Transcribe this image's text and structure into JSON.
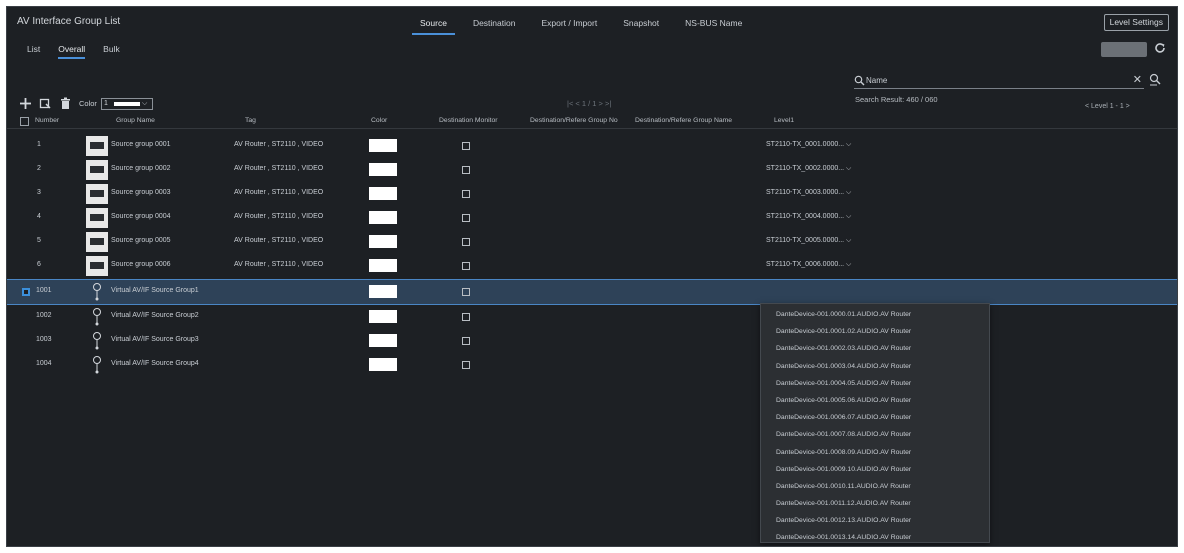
{
  "window": {
    "title": "AV Interface Group List",
    "level_settings_label": "Level Settings"
  },
  "top_tabs": [
    {
      "label": "Source",
      "active": true
    },
    {
      "label": "Destination",
      "active": false
    },
    {
      "label": "Export / Import",
      "active": false
    },
    {
      "label": "Snapshot",
      "active": false
    },
    {
      "label": "NS-BUS Name",
      "active": false
    }
  ],
  "sub_tabs": [
    {
      "label": "List",
      "active": false
    },
    {
      "label": "Overall",
      "active": true
    },
    {
      "label": "Bulk",
      "active": false
    }
  ],
  "search": {
    "placeholder": "Name",
    "result_label": "Search Result",
    "result_value": "460 / 060"
  },
  "toolbar": {
    "color_label": "Color",
    "color_value": "1",
    "pager": "|< < 1 / 1 > >|",
    "level_pager": "< Level 1 - 1 >"
  },
  "columns": {
    "number": "Number",
    "group_name": "Group Name",
    "tag": "Tag",
    "color": "Color",
    "destination_monitor": "Destination Monitor",
    "dest_no": "Destination/Refere Group No",
    "dest_name": "Destination/Refere Group Name",
    "level1": "Level1"
  },
  "rows": [
    {
      "number": "1",
      "name": "Source group 0001",
      "tag": "AV Router , ST2110 , VIDEO",
      "level1": "ST2110-TX_0001.0000...",
      "kind": "group",
      "selected": false
    },
    {
      "number": "2",
      "name": "Source group 0002",
      "tag": "AV Router , ST2110 , VIDEO",
      "level1": "ST2110-TX_0002.0000...",
      "kind": "group",
      "selected": false
    },
    {
      "number": "3",
      "name": "Source group 0003",
      "tag": "AV Router , ST2110 , VIDEO",
      "level1": "ST2110-TX_0003.0000...",
      "kind": "group",
      "selected": false
    },
    {
      "number": "4",
      "name": "Source group 0004",
      "tag": "AV Router , ST2110 , VIDEO",
      "level1": "ST2110-TX_0004.0000...",
      "kind": "group",
      "selected": false
    },
    {
      "number": "5",
      "name": "Source group 0005",
      "tag": "AV Router , ST2110 , VIDEO",
      "level1": "ST2110-TX_0005.0000...",
      "kind": "group",
      "selected": false
    },
    {
      "number": "6",
      "name": "Source group 0006",
      "tag": "AV Router , ST2110 , VIDEO",
      "level1": "ST2110-TX_0006.0000...",
      "kind": "group",
      "selected": false
    },
    {
      "number": "1001",
      "name": "Virtual AV/IF Source Group1",
      "tag": "",
      "level1": "",
      "kind": "virtual",
      "selected": true
    },
    {
      "number": "1002",
      "name": "Virtual AV/IF Source Group2",
      "tag": "",
      "level1": "",
      "kind": "virtual",
      "selected": false
    },
    {
      "number": "1003",
      "name": "Virtual AV/IF Source Group3",
      "tag": "",
      "level1": "",
      "kind": "virtual",
      "selected": false
    },
    {
      "number": "1004",
      "name": "Virtual AV/IF Source Group4",
      "tag": "",
      "level1": "",
      "kind": "virtual",
      "selected": false
    }
  ],
  "dropdown_items": [
    "DanteDevice-001.0000.01.AUDIO.AV Router",
    "DanteDevice-001.0001.02.AUDIO.AV Router",
    "DanteDevice-001.0002.03.AUDIO.AV Router",
    "DanteDevice-001.0003.04.AUDIO.AV Router",
    "DanteDevice-001.0004.05.AUDIO.AV Router",
    "DanteDevice-001.0005.06.AUDIO.AV Router",
    "DanteDevice-001.0006.07.AUDIO.AV Router",
    "DanteDevice-001.0007.08.AUDIO.AV Router",
    "DanteDevice-001.0008.09.AUDIO.AV Router",
    "DanteDevice-001.0009.10.AUDIO.AV Router",
    "DanteDevice-001.0010.11.AUDIO.AV Router",
    "DanteDevice-001.0011.12.AUDIO.AV Router",
    "DanteDevice-001.0012.13.AUDIO.AV Router",
    "DanteDevice-001.0013.14.AUDIO.AV Router"
  ],
  "colors": {
    "accent": "#4a90d9",
    "selected_row": "#2e4258",
    "background": "#1d2024"
  }
}
